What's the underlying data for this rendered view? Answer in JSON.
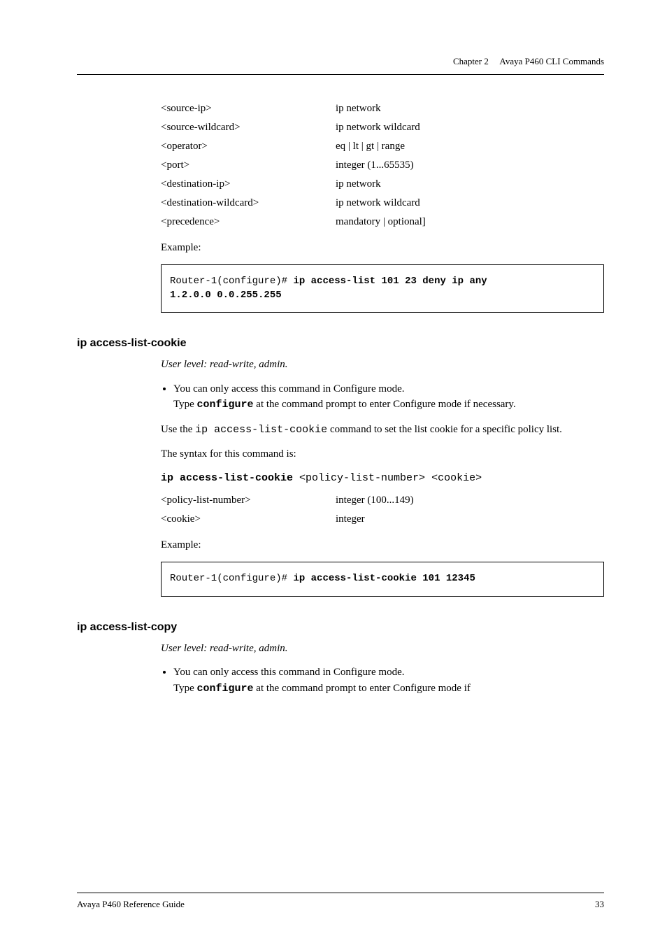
{
  "header": {
    "chapter": "Chapter 2",
    "title": "Avaya P460 CLI Commands"
  },
  "params1": [
    {
      "name": "<source-ip>",
      "desc": "ip network"
    },
    {
      "name": "<source-wildcard>",
      "desc": "ip network wildcard"
    },
    {
      "name": "<operator>",
      "desc": "eq | lt | gt | range"
    },
    {
      "name": "<port>",
      "desc": " integer (1...65535)"
    },
    {
      "name": "<destination-ip>",
      "desc": "ip network"
    },
    {
      "name": "<destination-wildcard>",
      "desc": "ip network wildcard"
    },
    {
      "name": "<precedence>",
      "desc": "mandatory | optional]"
    }
  ],
  "example_label": "Example:",
  "code1": {
    "prefix": "Router-1(configure)# ",
    "bold1": "ip access-list 101 23 deny ip any",
    "line2": "1.2.0.0 0.0.255.255"
  },
  "section1": {
    "heading": "ip access-list-cookie",
    "userlevel": "User level: read-write, admin.",
    "bullet_pre": "You can only access this command in Configure mode.",
    "bullet_type": "Type ",
    "bullet_cmd": "configure",
    "bullet_post": " at the command prompt to enter Configure mode if necessary.",
    "desc_pre": "Use the ",
    "desc_code": "ip access-list-cookie",
    "desc_post": " command to set the list cookie for a specific policy list.",
    "syntax_label": "The syntax for this command is:",
    "syntax_bold": "ip access-list-cookie",
    "syntax_rest": " <policy-list-number> <cookie>",
    "params": [
      {
        "name": "<policy-list-number>",
        "desc": "integer (100...149)"
      },
      {
        "name": "<cookie>",
        "desc": "integer"
      }
    ],
    "code": {
      "prefix": "Router-1(configure)# ",
      "bold": "ip access-list-cookie 101 12345"
    }
  },
  "section2": {
    "heading": "ip access-list-copy",
    "userlevel": "User level: read-write, admin.",
    "bullet_pre": "You can only access this command in Configure mode.",
    "bullet_type": "Type ",
    "bullet_cmd": "configure",
    "bullet_post": " at the command prompt to enter Configure mode if"
  },
  "footer": {
    "left": "Avaya P460 Reference Guide",
    "right": "33"
  }
}
